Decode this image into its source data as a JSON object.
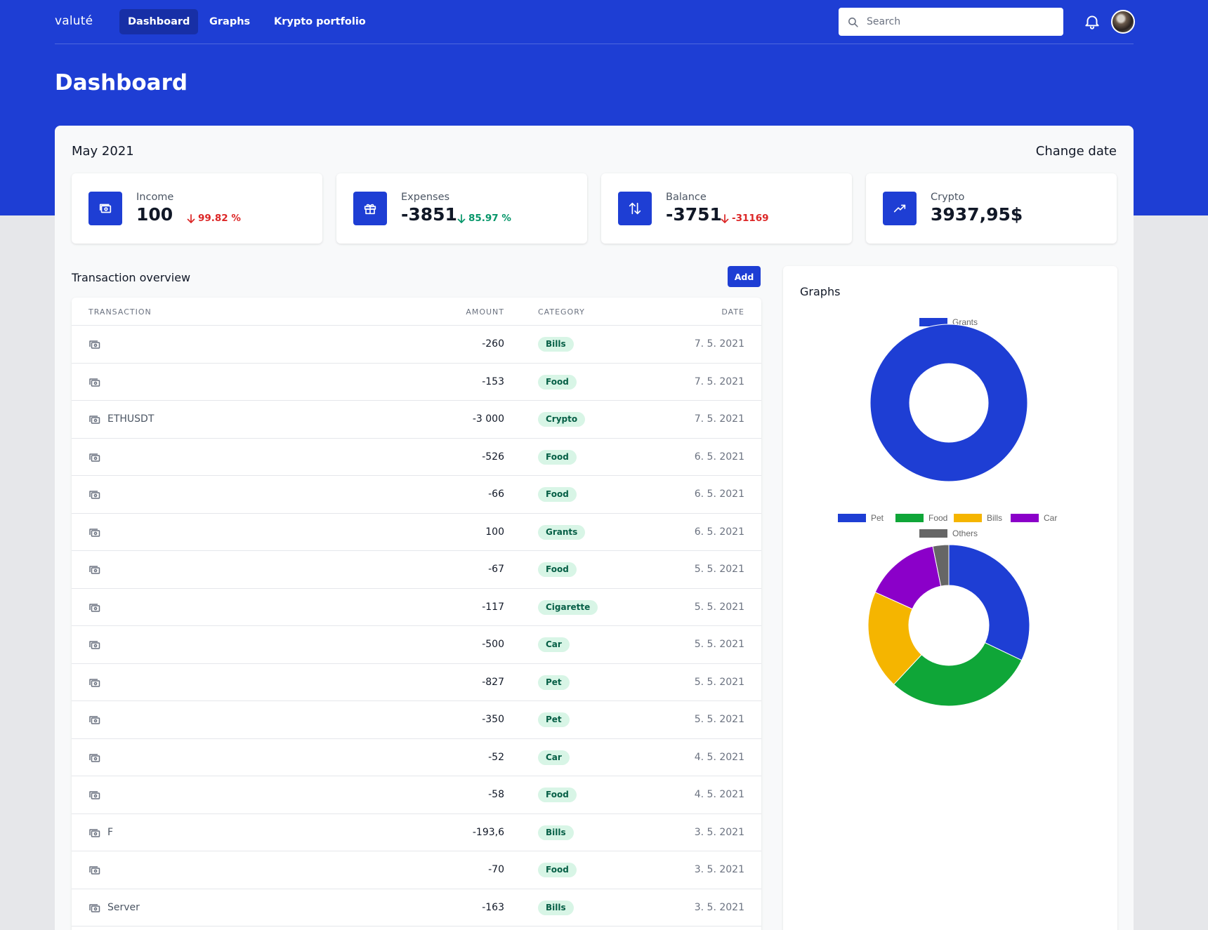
{
  "nav": {
    "brand": "valuté",
    "links": [
      "Dashboard",
      "Graphs",
      "Krypto portfolio"
    ],
    "active": 0,
    "search_placeholder": "Search"
  },
  "page_title": "Dashboard",
  "period": "May 2021",
  "change_date": "Change date",
  "stats": [
    {
      "label": "Income",
      "value": "100",
      "change": "99.82 %",
      "trend": "down",
      "tone": "neg",
      "icon": "cash-icon"
    },
    {
      "label": "Expenses",
      "value": "-3851",
      "change": "85.97 %",
      "trend": "down",
      "tone": "pos",
      "icon": "gift-icon"
    },
    {
      "label": "Balance",
      "value": "-3751",
      "change": "-31169",
      "trend": "down",
      "tone": "neg",
      "icon": "swap-icon"
    },
    {
      "label": "Crypto",
      "value": "3937,95$",
      "change": "",
      "icon": "trending-up-icon"
    }
  ],
  "transactions": {
    "title": "Transaction overview",
    "add_label": "Add",
    "headers": {
      "transaction": "TRANSACTION",
      "amount": "AMOUNT",
      "category": "CATEGORY",
      "date": "DATE"
    },
    "rows": [
      {
        "name": "",
        "amount": "-260",
        "category": "Bills",
        "date": "7. 5. 2021"
      },
      {
        "name": "",
        "amount": "-153",
        "category": "Food",
        "date": "7. 5. 2021"
      },
      {
        "name": "ETHUSDT",
        "amount": "-3 000",
        "category": "Crypto",
        "date": "7. 5. 2021"
      },
      {
        "name": "",
        "amount": "-526",
        "category": "Food",
        "date": "6. 5. 2021"
      },
      {
        "name": "",
        "amount": "-66",
        "category": "Food",
        "date": "6. 5. 2021"
      },
      {
        "name": "",
        "amount": "100",
        "category": "Grants",
        "date": "6. 5. 2021"
      },
      {
        "name": "",
        "amount": "-67",
        "category": "Food",
        "date": "5. 5. 2021"
      },
      {
        "name": "",
        "amount": "-117",
        "category": "Cigarette",
        "date": "5. 5. 2021"
      },
      {
        "name": "",
        "amount": "-500",
        "category": "Car",
        "date": "5. 5. 2021"
      },
      {
        "name": "",
        "amount": "-827",
        "category": "Pet",
        "date": "5. 5. 2021"
      },
      {
        "name": "",
        "amount": "-350",
        "category": "Pet",
        "date": "5. 5. 2021"
      },
      {
        "name": "",
        "amount": "-52",
        "category": "Car",
        "date": "4. 5. 2021"
      },
      {
        "name": "",
        "amount": "-58",
        "category": "Food",
        "date": "4. 5. 2021"
      },
      {
        "name": "F",
        "amount": "-193,6",
        "category": "Bills",
        "date": "3. 5. 2021"
      },
      {
        "name": "",
        "amount": "-70",
        "category": "Food",
        "date": "3. 5. 2021"
      },
      {
        "name": "Server",
        "amount": "-163",
        "category": "Bills",
        "date": "3. 5. 2021"
      }
    ]
  },
  "graphs": {
    "title": "Graphs"
  },
  "chart_data": [
    {
      "type": "pie",
      "donut": true,
      "categories": [
        "Grants"
      ],
      "values": [
        100
      ],
      "colors": [
        "#1e3ed4"
      ],
      "legend": "top"
    },
    {
      "type": "pie",
      "donut": true,
      "categories": [
        "Pet",
        "Food",
        "Bills",
        "Car",
        "Others"
      ],
      "values": [
        1177,
        1093,
        726.6,
        552,
        117
      ],
      "colors": [
        "#1e3ed4",
        "#0fa638",
        "#f5b500",
        "#8b00c9",
        "#666666"
      ],
      "legend": "top"
    }
  ]
}
